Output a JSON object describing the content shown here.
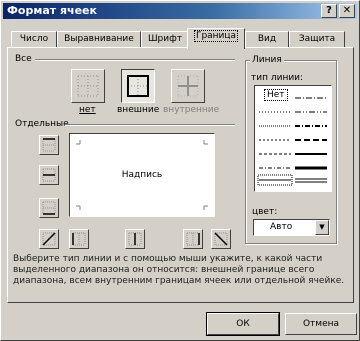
{
  "window": {
    "title": "Формат ячеек",
    "help_glyph": "?",
    "close_glyph": "✕"
  },
  "tabs": [
    {
      "label": "Число"
    },
    {
      "label": "Выравнивание"
    },
    {
      "label": "Шрифт"
    },
    {
      "label": "Граница",
      "active": true
    },
    {
      "label": "Вид"
    },
    {
      "label": "Защита"
    }
  ],
  "presets": {
    "section_label": "Все",
    "items": [
      {
        "label": "нет",
        "icon": "border-none-icon"
      },
      {
        "label": "внешние",
        "icon": "border-outline-icon",
        "pressed": true
      },
      {
        "label": "внутренние",
        "icon": "border-inside-icon",
        "disabled": true
      }
    ]
  },
  "individual": {
    "section_label": "Отдельные"
  },
  "preview": {
    "text": "Надпись"
  },
  "line": {
    "group_label": "Линия",
    "type_label": "тип линии:",
    "none_label": "Нет",
    "color_label": "цвет:",
    "color_value": "Авто"
  },
  "help_text": "Выберите тип линии и с помощью мыши укажите, к какой части выделенного диапазона он относится: внешней границе всего диапазона, всем внутренним границам ячеек или отдельной ячейке.",
  "buttons": {
    "ok": "ОК",
    "cancel": "Отмена"
  }
}
